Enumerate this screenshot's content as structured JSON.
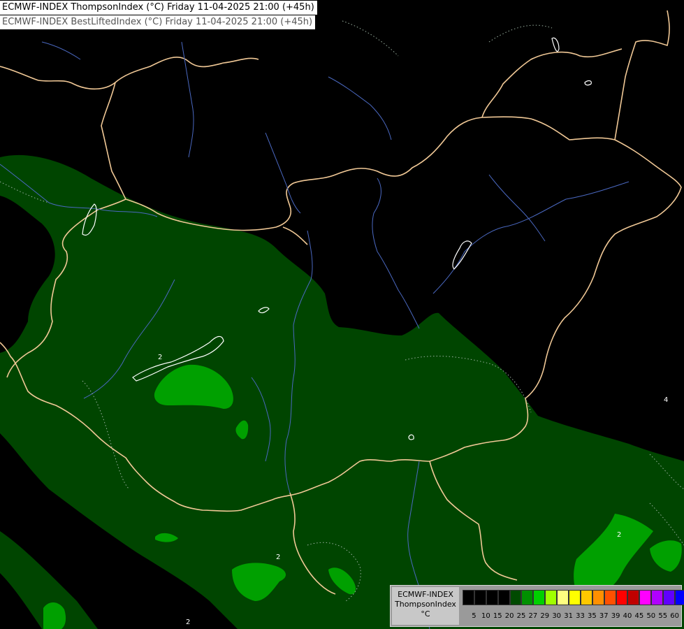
{
  "header": {
    "line1": "ECMWF-INDEX ThompsonIndex (°C) Friday 11-04-2025 21:00 (+45h)",
    "line2": "ECMWF-INDEX BestLiftedIndex (°C) Friday 11-04-2025 21:00 (+45h)"
  },
  "legend": {
    "line1": "ECMWF-INDEX",
    "line2": "ThompsonIndex",
    "line3": "°C",
    "ticks": [
      "5",
      "10",
      "15",
      "20",
      "25",
      "27",
      "29",
      "30",
      "31",
      "33",
      "35",
      "37",
      "39",
      "40",
      "45",
      "50",
      "55",
      "60"
    ],
    "colors": [
      "#000000",
      "#000000",
      "#000000",
      "#000000",
      "#004a00",
      "#009000",
      "#00d000",
      "#a0ff00",
      "#ffff80",
      "#ffff00",
      "#ffc800",
      "#ff9000",
      "#ff5000",
      "#ff0000",
      "#c00000",
      "#ff00ff",
      "#b000ff",
      "#6000ff",
      "#0000ff"
    ]
  },
  "map": {
    "colors": {
      "background": "#000000",
      "low_band": "#004500",
      "mid_band": "#00a000",
      "borders": "#f0c896",
      "rivers": "#5070c0",
      "contours": "#ffffff"
    },
    "contour_labels": [
      "2",
      "2",
      "2",
      "2",
      "4"
    ]
  }
}
